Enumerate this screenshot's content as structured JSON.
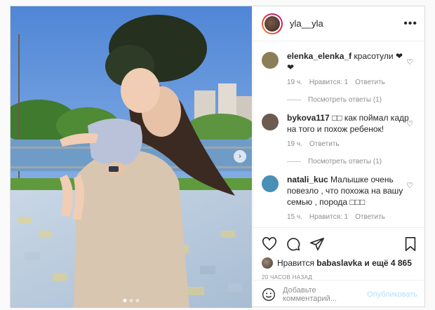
{
  "post": {
    "username": "yla__yla",
    "more_label": "•••"
  },
  "comments": [
    {
      "username": "elenka_elenka_f",
      "text": "красотули ❤❤",
      "time": "19 ч.",
      "likes": "Нравится: 1",
      "reply": "Ответить",
      "view_replies": "Посмотреть ответы (1)",
      "avatar_color": "#8a7f58"
    },
    {
      "username": "bykova117",
      "text": "□□ как поймал кадр на того и похож ребенок!",
      "time": "19 ч.",
      "likes": "",
      "reply": "Ответить",
      "view_replies": "Посмотреть ответы (1)",
      "avatar_color": "#6b5b50"
    },
    {
      "username": "natali_kuc",
      "text": "Малышке очень повезло , что похожа на вашу семью , порода □□□",
      "time": "15 ч.",
      "likes": "Нравится: 1",
      "reply": "Ответить",
      "view_replies": "",
      "avatar_color": "#4a8fb5"
    }
  ],
  "likes": {
    "prefix": "Нравится",
    "user": "babaslavka",
    "suffix": "и ещё 4 865"
  },
  "timestamp": "20 ЧАСОВ НАЗАД",
  "add_comment": {
    "placeholder": "Добавьте комментарий...",
    "post_label": "Опубликовать"
  },
  "carousel": {
    "next_glyph": "›"
  },
  "colors": {
    "sky": "#5b8fd8",
    "accent": "#0095f6"
  }
}
